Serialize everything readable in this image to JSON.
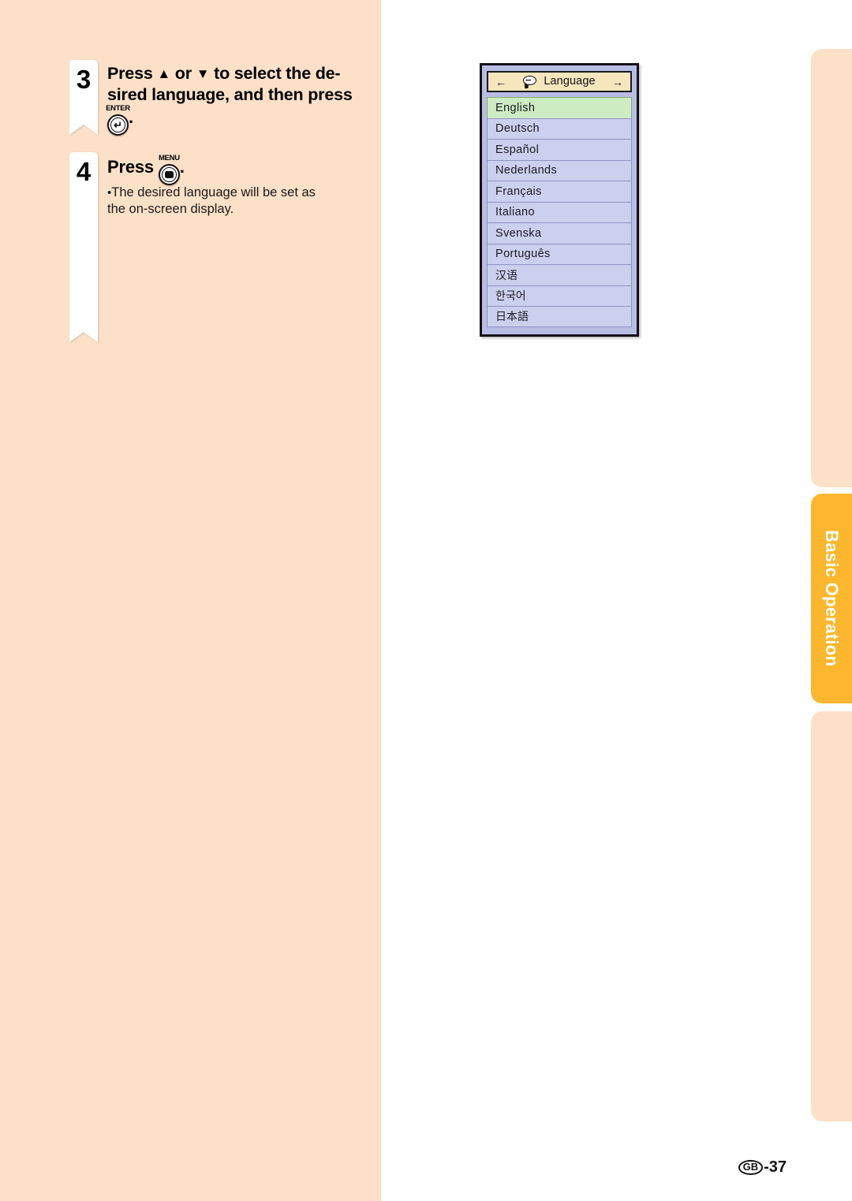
{
  "page": {
    "background_left_color": "#fce0c8",
    "background_right_color": "#ffffff"
  },
  "side_tab": {
    "label": "Basic Operation",
    "active_color": "#fdb72e",
    "inactive_color": "#fce0c8"
  },
  "steps": [
    {
      "number": "3",
      "text_before_key": "Press",
      "up_arrow": "▲",
      "text_or": "or",
      "down_arrow": "▼",
      "text_after_arrows": "to select the de-",
      "line2": "sired language, and then press",
      "key_label": "ENTER",
      "key_glyph": "↵",
      "trailing_period": "."
    },
    {
      "number": "4",
      "text_before_key": "Press",
      "key_label": "MENU",
      "key_glyph": "menu-screen-icon",
      "trailing_period": ".",
      "note_bullet": "•",
      "note_line_1": "The desired language will be set as",
      "note_line_2": "the on-screen display."
    }
  ],
  "osd_menu": {
    "header": {
      "left_arrow": "←",
      "right_arrow": "→",
      "icon": "speech-bubble-icon",
      "icon_dots": "••••",
      "title": "Language",
      "background_color": "#f6e6bc"
    },
    "selected_index": 0,
    "selected_color": "#cdecc1",
    "item_color": "#ccd0ef",
    "items": [
      {
        "label": "English",
        "cjk": false
      },
      {
        "label": "Deutsch",
        "cjk": false
      },
      {
        "label": "Español",
        "cjk": false
      },
      {
        "label": "Nederlands",
        "cjk": false
      },
      {
        "label": "Français",
        "cjk": false
      },
      {
        "label": "Italiano",
        "cjk": false
      },
      {
        "label": "Svenska",
        "cjk": false
      },
      {
        "label": "Português",
        "cjk": false
      },
      {
        "label": "汉语",
        "cjk": true
      },
      {
        "label": "한국어",
        "cjk": true
      },
      {
        "label": "日本語",
        "cjk": true
      }
    ]
  },
  "footer": {
    "region_code": "GB",
    "page_number": "-37"
  }
}
